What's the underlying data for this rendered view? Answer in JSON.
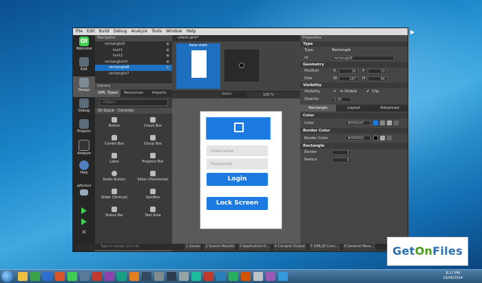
{
  "menu": [
    "File",
    "Edit",
    "Build",
    "Debug",
    "Analyze",
    "Tools",
    "Window",
    "Help",
    "Edit"
  ],
  "modes": [
    {
      "label": "Welcome",
      "icon": "qt-logo-icon"
    },
    {
      "label": "Edit",
      "icon": "edit-icon"
    },
    {
      "label": "Design",
      "icon": "design-icon"
    },
    {
      "label": "Debug",
      "icon": "debug-icon"
    },
    {
      "label": "Projects",
      "icon": "projects-icon"
    },
    {
      "label": "Analyze",
      "icon": "analyze-icon"
    },
    {
      "label": "Help",
      "icon": "help-icon"
    }
  ],
  "kit_label": "qtfb2test",
  "navigator": {
    "title": "Navigator",
    "items": [
      "rectangle5",
      "text1",
      "text2",
      "rectangle10",
      "rectangle8",
      "rectangle7"
    ]
  },
  "library": {
    "title": "Library",
    "tabs": [
      "QML Types",
      "Resources",
      "Imports"
    ],
    "filter_placeholder": "<Filter>",
    "category": "Qt Quick - Controls",
    "items": [
      "Button",
      "Check Box",
      "Combo Box",
      "Group Box",
      "Label",
      "Progress Bar",
      "Radio Button",
      "Slider (Horizontal)",
      "Slider (Vertical)",
      "SpinBox",
      "Status Bar",
      "Text Area"
    ]
  },
  "editor": {
    "file_tab": "uitest.qml*",
    "state_name": "base state",
    "width_label": "Width",
    "zoom": "100 %",
    "username_placeholder": "Username",
    "password_placeholder": "Password",
    "login_label": "Login",
    "lock_label": "Lock Screen"
  },
  "properties": {
    "title": "Properties",
    "type_section": "Type",
    "type_label": "Type",
    "type_value": "Rectangle",
    "id_label": "id",
    "id_value": "rectangle8",
    "geometry_section": "Geometry",
    "position_label": "Position",
    "size_label": "Size",
    "x_label": "X",
    "y_label": "Y",
    "w_label": "W",
    "h_label": "H",
    "x": "16",
    "y": "10",
    "w": "187",
    "h": "66",
    "visibility_section": "Visibility",
    "visibility_label": "Visibility",
    "is_visible": "Is Visible",
    "clip": "Clip",
    "opacity_label": "Opacity",
    "opacity": "1,00",
    "tabs": [
      "Rectangle",
      "Layout",
      "Advanced"
    ],
    "color_section": "Color",
    "color_label": "Color",
    "color_value": "#0492d7",
    "border_color_section": "Border Color",
    "border_color_label": "Border Color",
    "border_color_value": "#000000",
    "rectangle_section": "Rectangle",
    "border_label": "Border",
    "border": "1",
    "radius_label": "Radius",
    "radius": "4"
  },
  "search_placeholder": "Type to locate (Ctrl+K)",
  "output_tabs": [
    "1 Issues",
    "2 Search Results",
    "3 Application O...",
    "4 Compile Output",
    "5 QML/JS Cons...",
    "6 General Mess..."
  ],
  "clock": {
    "time": "8:17 PM",
    "date": "16/06/2014"
  },
  "watermark": {
    "part1": "Get",
    "part2": "On",
    "part3": "Files"
  },
  "colors": {
    "accent": "#1d7ae0",
    "selection": "#1d72c4",
    "qt_green": "#41cd52"
  }
}
